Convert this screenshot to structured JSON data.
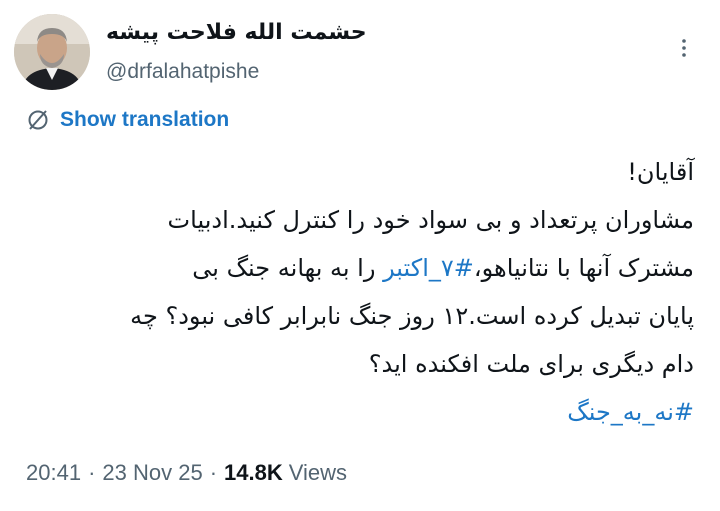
{
  "author": {
    "display_name": "حشمت الله فلاحت پیشه",
    "handle": "@drfalahatpishe"
  },
  "translation": {
    "label": "Show translation"
  },
  "tweet": {
    "line1": "آقایان!",
    "line2": "مشاوران پرتعداد و بی سواد خود را کنترل کنید.ادبیات",
    "line3_before": "مشترک آنها با نتانیاهو،",
    "line3_hashtag": "#۷_اکتبر",
    "line3_after": " را به بهانه جنگ بی",
    "line4": "پایان تبدیل کرده است.۱۲ روز جنگ نابرابر کافی نبود؟ چه",
    "line5": "دام دیگری برای ملت افکنده اید؟",
    "hashtag2": "#نه_به_جنگ"
  },
  "meta": {
    "time": "20:41",
    "date": "23 Nov 25",
    "views_count": "14.8K",
    "views_label": "Views"
  },
  "colors": {
    "link": "#1d77c6",
    "secondary": "#536471",
    "text": "#0f1419"
  },
  "icons": {
    "more": "more-icon",
    "translate": "translate-icon"
  }
}
